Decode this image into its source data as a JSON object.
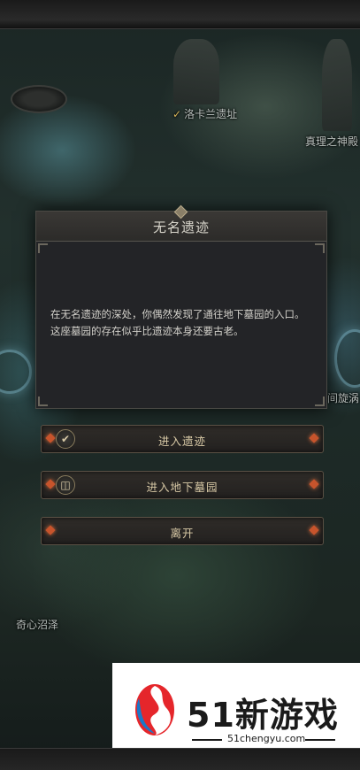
{
  "map": {
    "locations": [
      {
        "name": "洛卡兰遗址",
        "visited": true
      },
      {
        "name": "真理之神殿",
        "visited": false
      },
      {
        "name": "间旋涡",
        "visited": false
      },
      {
        "name": "奇心沼泽",
        "visited": false
      }
    ]
  },
  "dialog": {
    "title": "无名遗迹",
    "body": "在无名遗迹的深处，你偶然发现了通往地下墓园的入口。这座墓园的存在似乎比遗迹本身还要古老。"
  },
  "choices": [
    {
      "label": "进入遗迹",
      "icon": "checkmark-emblem-icon"
    },
    {
      "label": "进入地下墓园",
      "icon": "gate-emblem-icon"
    },
    {
      "label": "离开",
      "icon": ""
    }
  ],
  "watermark": {
    "title": "51新游戏",
    "url": "51chengyu.com"
  },
  "colors": {
    "accent_gem": "#c7542c",
    "choice_text": "#d8c9a6",
    "check": "#d6b55a"
  }
}
